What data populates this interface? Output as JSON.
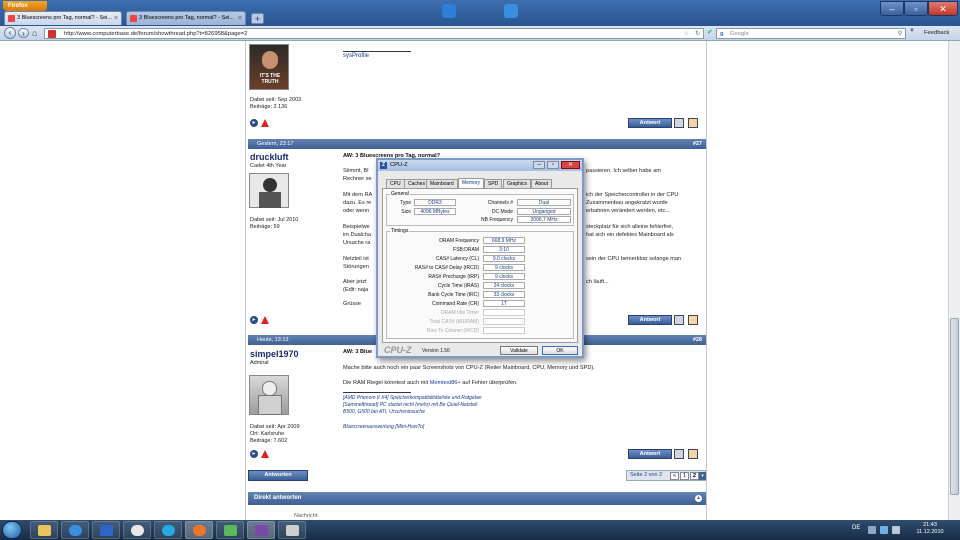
{
  "browser": {
    "menu_button": "Firefox",
    "tabs": [
      {
        "label": "3 Bluescreens pro Tag, normal? - Sei...",
        "active": true
      },
      {
        "label": "3 Bluescreens pro Tag, normal? - Sei...",
        "active": false
      }
    ],
    "new_tab": "+",
    "window_controls": {
      "minimize": "–",
      "maximize": "▫",
      "close": "✕"
    },
    "url": "http://www.computerbase.de/forum/showthread.php?t=826958&page=2",
    "search_placeholder": "Google",
    "feedback": "Feedback"
  },
  "posts": [
    {
      "signature_link": "sysProfile",
      "avatar_caption": "IT'S THE TRUTH",
      "joined": "Dabei seit: Sep 2003",
      "posts_count": "Beiträge: 2.136"
    },
    {
      "date": "Gestern, 23:17",
      "number": "#27",
      "username": "druckluft",
      "rank": "Cadet 4th Year",
      "joined": "Dabei seit: Jul 2010",
      "posts_count": "Beiträge: 59",
      "title": "AW: 3 Bluescreens pro Tag, normal?",
      "lines": [
        "Stimmt, Bl",
        "Rechner se",
        "Mit dem RA",
        "dazu. Es re",
        "oder wenn",
        "Beispielwe",
        "im Dualcha",
        "Ursache ra",
        "Netzteil ist",
        "Störungen",
        "Aber jetzt",
        "(Edit: naja",
        "Grüsse"
      ],
      "lines_right": [
        "passieren. Ich selber habe am",
        "",
        "ich der Speichercontroller in der CPU",
        "Zusammenbau angekratzt wurde",
        "erbahnen verändert werden, etc...",
        "",
        "steckplatz für sich alleine fehlerfrei,",
        "hat sich ein defektes Mainboard als",
        "",
        "sein der CPU bemerkbar solange man",
        "",
        "ch läuft..."
      ]
    },
    {
      "date": "Heute, 13:13",
      "number": "#28",
      "username": "simpel1970",
      "rank": "Admiral",
      "joined": "Dabei seit: Apr 2009",
      "location": "Ort: Karlsruhe",
      "posts_count": "Beiträge: 7.602",
      "title": "AW: 3 Blue",
      "text1": "Mache bitte auch noch ein paar Screenshots von CPU-Z (Reiter Mainboard, CPU, Memory und SPD).",
      "text2_a": "Die RAM Riegel könntest auch mit ",
      "text2_link": "Memtest86+",
      "text2_b": " auf Fehler überprüfen.",
      "sig_lines": [
        "[AMD Phenom II X4] Speicherkompatibilitätsliste und Ratgeber",
        "[Sammelthread] PC startet nicht (mehr) mit Be Quiet-Netzteil",
        "B500, G500 bei ATI, Urscheninsuche",
        "",
        "Bluescreenauswertung [Mini-HowTo]"
      ]
    }
  ],
  "reply_label": "Antwort",
  "answer_label": "Antworten",
  "pagination": {
    "label": "Seite 2 von 2",
    "prev": "<",
    "pages": [
      "1",
      "2"
    ]
  },
  "direct_reply": {
    "title": "Direkt antworten",
    "field_label": "Nachricht:"
  },
  "cpuz": {
    "title": "CPU-Z",
    "tabs": [
      "CPU",
      "Caches",
      "Mainboard",
      "Memory",
      "SPD",
      "Graphics",
      "About"
    ],
    "active_tab": "Memory",
    "general_label": "General",
    "type_label": "Type",
    "type": "DDR3",
    "size_label": "Size",
    "size": "4096 MBytes",
    "channels_label": "Channels #",
    "channels": "Dual",
    "dcmode_label": "DC Mode",
    "dcmode": "Unganged",
    "nbfreq_label": "NB Frequency",
    "nbfreq": "2006.7 MHz",
    "timings_label": "Timings",
    "timings": [
      {
        "label": "DRAM Frequency",
        "value": "668.9 MHz"
      },
      {
        "label": "FSB:DRAM",
        "value": "3:10"
      },
      {
        "label": "CAS# Latency (CL)",
        "value": "9.0 clocks"
      },
      {
        "label": "RAS# to CAS# Delay (tRCD)",
        "value": "9 clocks"
      },
      {
        "label": "RAS# Precharge (tRP)",
        "value": "9 clocks"
      },
      {
        "label": "Cycle Time (tRAS)",
        "value": "24 clocks"
      },
      {
        "label": "Bank Cycle Time (tRC)",
        "value": "33 clocks"
      },
      {
        "label": "Command Rate (CR)",
        "value": "1T"
      },
      {
        "label": "DRAM Idle Timer",
        "value": ""
      },
      {
        "label": "Total CAS# (tRDRAM)",
        "value": ""
      },
      {
        "label": "Row To Column (tRCD)",
        "value": ""
      }
    ],
    "brand": "CPU-Z",
    "version": "Version 1.56",
    "validate": "Validate",
    "ok": "OK"
  },
  "taskbar": {
    "language": "DE",
    "time": "21:43",
    "date": "11.12.2010"
  }
}
